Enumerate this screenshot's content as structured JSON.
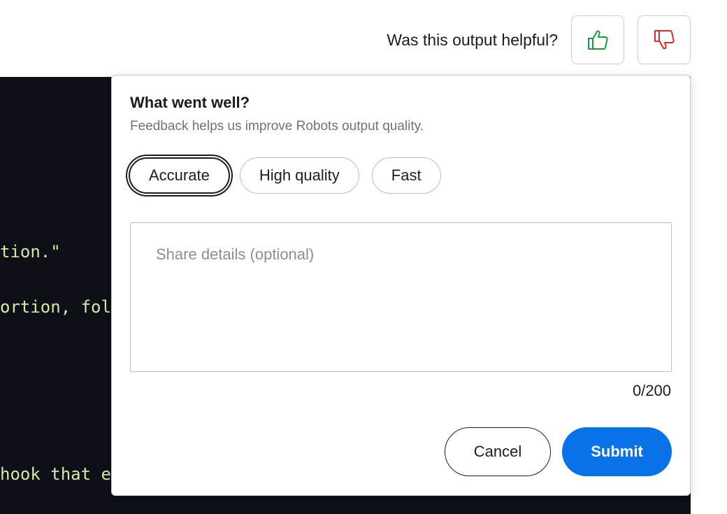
{
  "feedback": {
    "question": "Was this output helpful?",
    "thumbs_up_color": "#1a9a3a",
    "thumbs_down_color": "#d92b2b"
  },
  "code": {
    "lines": [
      "tion.\"",
      "ortion, fol",
      "hook that e"
    ]
  },
  "popover": {
    "title": "What went well?",
    "subtitle": "Feedback helps us improve Robots output quality.",
    "chips": [
      "Accurate",
      "High quality",
      "Fast"
    ],
    "selected_chip": "Accurate",
    "details_placeholder": "Share details (optional)",
    "details_value": "",
    "char_count": "0/200",
    "cancel_label": "Cancel",
    "submit_label": "Submit",
    "submit_color": "#0a72e8"
  }
}
